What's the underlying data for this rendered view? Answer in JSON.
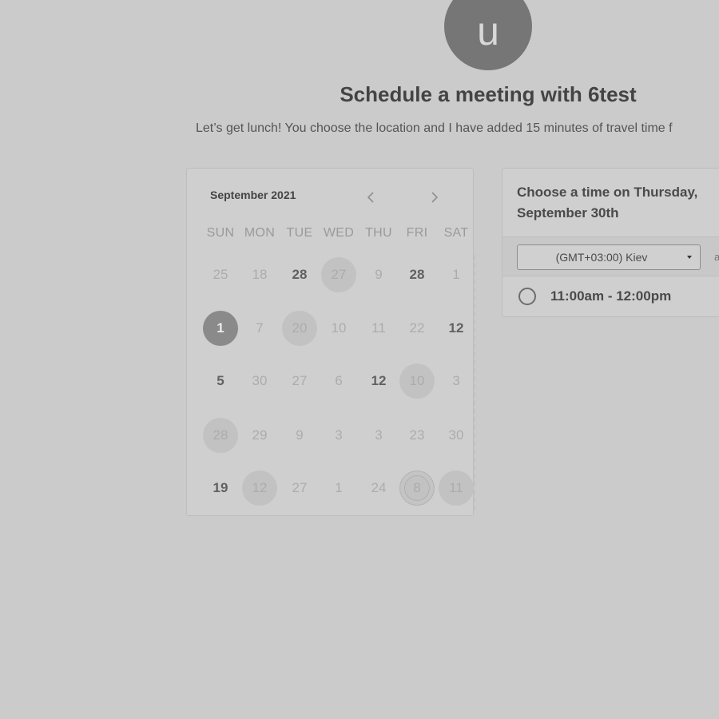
{
  "header": {
    "avatar_initial": "u",
    "title": "Schedule a meeting with 6test",
    "description": "Let’s get lunch! You choose the location and I have added 15 minutes of travel time f"
  },
  "calendar": {
    "month_label": "September 2021",
    "prev_icon": "chevron-left-icon",
    "next_icon": "chevron-right-icon",
    "weekdays": [
      "SUN",
      "MON",
      "TUE",
      "WED",
      "THU",
      "FRI",
      "SAT"
    ],
    "weeks": [
      [
        {
          "label": "25",
          "state": "muted"
        },
        {
          "label": "18",
          "state": "muted"
        },
        {
          "label": "28",
          "state": "bold"
        },
        {
          "label": "27",
          "state": "shaded"
        },
        {
          "label": "9",
          "state": "muted"
        },
        {
          "label": "28",
          "state": "bold"
        },
        {
          "label": "1",
          "state": "muted"
        }
      ],
      [
        {
          "label": "1",
          "state": "selected"
        },
        {
          "label": "7",
          "state": "muted"
        },
        {
          "label": "20",
          "state": "shaded"
        },
        {
          "label": "10",
          "state": "muted"
        },
        {
          "label": "11",
          "state": "muted"
        },
        {
          "label": "22",
          "state": "muted"
        },
        {
          "label": "12",
          "state": "bold"
        }
      ],
      [
        {
          "label": "5",
          "state": "bold"
        },
        {
          "label": "30",
          "state": "muted"
        },
        {
          "label": "27",
          "state": "muted"
        },
        {
          "label": "6",
          "state": "muted"
        },
        {
          "label": "12",
          "state": "bold"
        },
        {
          "label": "10",
          "state": "shaded"
        },
        {
          "label": "3",
          "state": "muted"
        }
      ],
      [
        {
          "label": "28",
          "state": "shaded"
        },
        {
          "label": "29",
          "state": "muted"
        },
        {
          "label": "9",
          "state": "muted"
        },
        {
          "label": "3",
          "state": "muted"
        },
        {
          "label": "3",
          "state": "muted"
        },
        {
          "label": "23",
          "state": "muted"
        },
        {
          "label": "30",
          "state": "muted"
        }
      ],
      [
        {
          "label": "19",
          "state": "bold"
        },
        {
          "label": "12",
          "state": "shaded"
        },
        {
          "label": "27",
          "state": "muted"
        },
        {
          "label": "1",
          "state": "muted"
        },
        {
          "label": "24",
          "state": "muted"
        },
        {
          "label": "8",
          "state": "dotted"
        },
        {
          "label": "11",
          "state": "shaded"
        }
      ]
    ]
  },
  "time_panel": {
    "heading": "Choose a time on Thursday, September 30th",
    "timezone": "(GMT+03:00) Kiev",
    "timezone_extra": "a",
    "caret_icon": "caret-down-icon",
    "slots": [
      {
        "label": "11:00am - 12:00pm",
        "selected": false
      }
    ]
  },
  "colors": {
    "background": "#cbcbcb",
    "avatar": "#767676",
    "selected_day": "#8a8a8a",
    "shaded_day": "#c2c2c2"
  }
}
